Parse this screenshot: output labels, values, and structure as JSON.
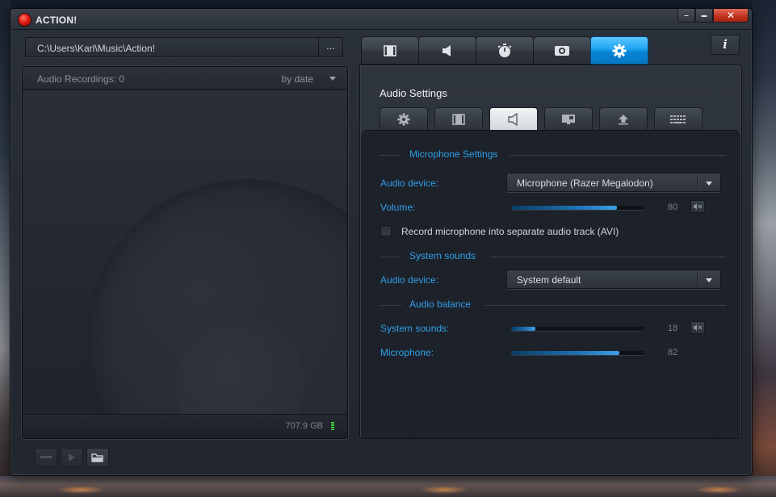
{
  "app": {
    "title": "ACTION!",
    "window_controls": {
      "minimize": "–",
      "maximize": "▬",
      "close": "✕"
    }
  },
  "path": {
    "value": "C:\\Users\\Karl\\Music\\Action!",
    "browse_label": "..."
  },
  "recordings": {
    "header": "Audio Recordings: 0",
    "sort_label": "by date",
    "disk_free": "707.9 GB"
  },
  "main_tabs": [
    {
      "name": "video",
      "icon": "film-icon"
    },
    {
      "name": "audio",
      "icon": "speaker-icon"
    },
    {
      "name": "benchmark",
      "icon": "stopwatch-icon"
    },
    {
      "name": "screenshots",
      "icon": "camera-icon"
    },
    {
      "name": "settings",
      "icon": "gear-icon",
      "active": true
    }
  ],
  "info_label": "i",
  "settings": {
    "title": "Audio Settings",
    "sub_tabs": [
      {
        "name": "general",
        "icon": "gear-icon"
      },
      {
        "name": "video",
        "icon": "film-icon"
      },
      {
        "name": "audio",
        "icon": "speaker-icon",
        "active": true
      },
      {
        "name": "display",
        "icon": "monitor-icon"
      },
      {
        "name": "upload",
        "icon": "upload-icon"
      },
      {
        "name": "hotkeys",
        "icon": "keyboard-icon"
      }
    ],
    "microphone": {
      "section_label": "Microphone Settings",
      "device_label": "Audio device:",
      "device_value": "Microphone (Razer Megalodon)",
      "volume_label": "Volume:",
      "volume_value": "80",
      "volume_level": 80,
      "separate_track_label": "Record microphone into separate audio track (AVI)",
      "separate_track_checked": false
    },
    "system_sounds": {
      "section_label": "System sounds",
      "device_label": "Audio device:",
      "device_value": "System default"
    },
    "balance": {
      "section_label": "Audio balance",
      "system_label": "System sounds:",
      "system_value": "18",
      "system_level": 18,
      "mic_label": "Microphone:",
      "mic_value": "82",
      "mic_level": 82
    }
  },
  "colors": {
    "accent": "#2f9fe8",
    "active_tab": "#1ea4f2",
    "close_button": "#c0321e",
    "logo": "#e31a10",
    "disk_meter": "#3ed43a"
  }
}
